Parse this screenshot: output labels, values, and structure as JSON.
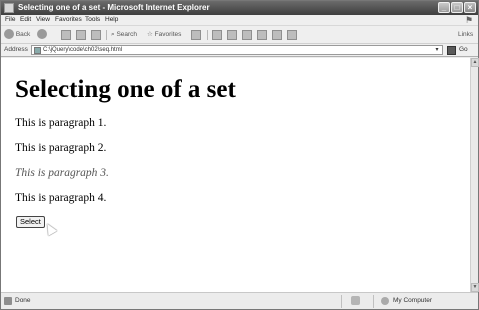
{
  "window": {
    "title": "Selecting one of a set - Microsoft Internet Explorer",
    "controls": {
      "minimize": "_",
      "maximize": "□",
      "close": "×"
    }
  },
  "menu": [
    "File",
    "Edit",
    "View",
    "Favorites",
    "Tools",
    "Help"
  ],
  "toolbar": {
    "back": "Back",
    "search": "Search",
    "favorites": "Favorites",
    "links": "Links"
  },
  "address": {
    "label": "Address",
    "url": "C:\\jQuery\\code\\ch02\\seq.html",
    "go": "Go"
  },
  "page": {
    "heading": "Selecting one of a set",
    "paragraphs": [
      "This is paragraph 1.",
      "This is paragraph 2.",
      "This is paragraph 3.",
      "This is paragraph 4."
    ],
    "button": "Select"
  },
  "status": {
    "text": "Done",
    "zone": "My Computer"
  },
  "icons": {
    "back": "back-arrow-icon",
    "forward": "forward-arrow-icon",
    "stop": "stop-icon",
    "refresh": "refresh-icon",
    "home": "home-icon",
    "search": "search-icon",
    "favorites": "favorites-star-icon",
    "media": "media-icon",
    "history": "history-icon",
    "mail": "mail-icon",
    "print": "print-icon",
    "edit": "edit-icon",
    "discuss": "discuss-icon",
    "messenger": "messenger-icon"
  }
}
